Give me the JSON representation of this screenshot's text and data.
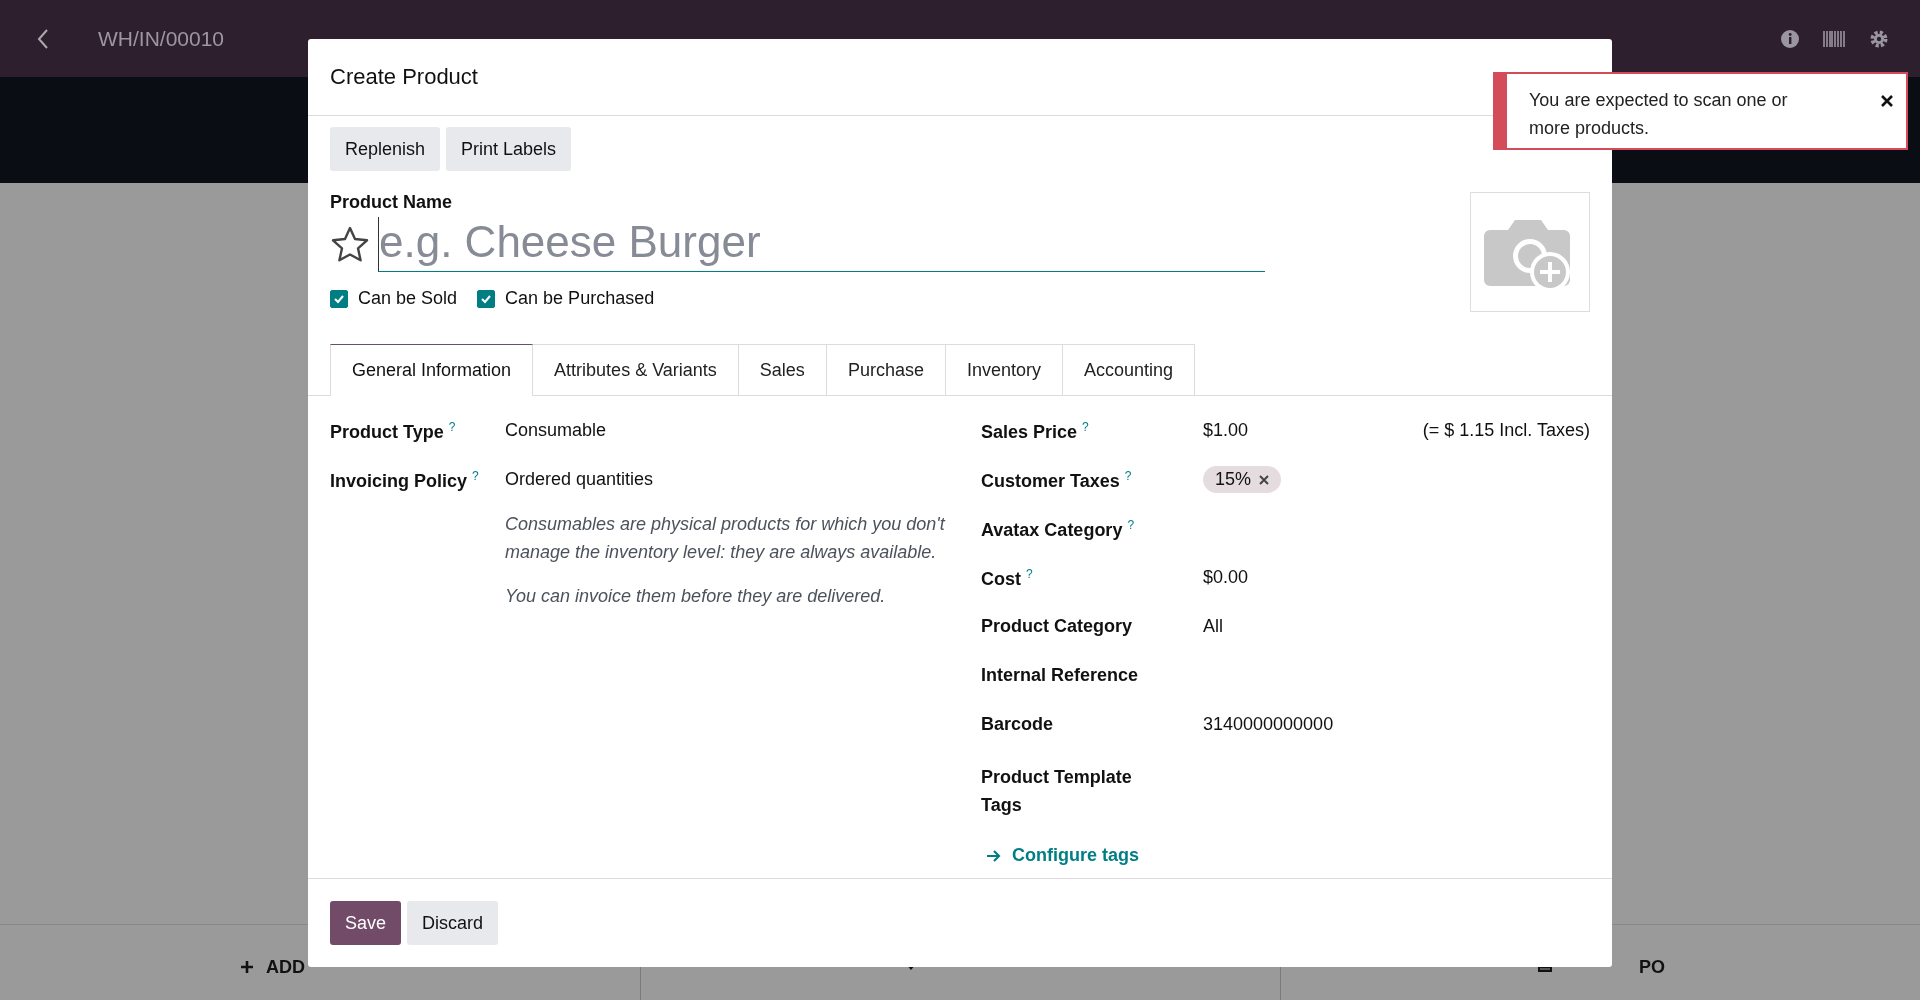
{
  "topbar": {
    "title": "WH/IN/00010"
  },
  "bottom_actions": [
    {
      "kind": "add",
      "label": "ADD"
    },
    {
      "kind": "validate"
    },
    {
      "kind": "create",
      "label": "PO"
    }
  ],
  "dialog": {
    "title": "Create Product",
    "header_buttons": [
      "Replenish",
      "Print Labels"
    ],
    "name_label": "Product Name",
    "name_placeholder": "e.g. Cheese Burger",
    "favorite": false,
    "options": [
      {
        "label": "Can be Sold",
        "checked": true
      },
      {
        "label": "Can be Purchased",
        "checked": true
      }
    ],
    "tabs": [
      {
        "label": "General Information",
        "selected": true
      },
      {
        "label": "Attributes & Variants",
        "selected": false
      },
      {
        "label": "Sales",
        "selected": false
      },
      {
        "label": "Purchase",
        "selected": false
      },
      {
        "label": "Inventory",
        "selected": false
      },
      {
        "label": "Accounting",
        "selected": false
      }
    ],
    "left_fields": [
      {
        "label": "Product Type",
        "help": "?",
        "value": "Consumable"
      },
      {
        "label": "Invoicing Policy",
        "help": "?",
        "value": "Ordered quantities"
      }
    ],
    "notes": [
      "Consumables are physical products for which you don't manage the inventory level: they are always available.",
      "You can invoice them before they are delivered."
    ],
    "right_fields": [
      {
        "label": "Sales Price",
        "help": "?",
        "kind": "text",
        "value": "$1.00",
        "extra": "(= $ 1.15 Incl. Taxes)"
      },
      {
        "label": "Customer Taxes",
        "help": "?",
        "kind": "tag",
        "value": "15%"
      },
      {
        "label": "Avatax Category",
        "help": "?",
        "kind": "text"
      },
      {
        "label": "Cost",
        "help": "?",
        "kind": "text",
        "value": "$0.00"
      },
      {
        "label": "Product Category",
        "kind": "text",
        "value": "All"
      },
      {
        "label": "Internal Reference",
        "kind": "text"
      },
      {
        "label": "Barcode",
        "kind": "text",
        "value": "3140000000000"
      },
      {
        "label": "Product Template Tags",
        "kind": "text"
      }
    ],
    "link": "Configure tags",
    "footer_buttons": [
      {
        "label": "Save",
        "primary": true
      },
      {
        "label": "Discard",
        "primary": false
      }
    ]
  },
  "notification": {
    "message": "You are expected to scan one or more products."
  }
}
